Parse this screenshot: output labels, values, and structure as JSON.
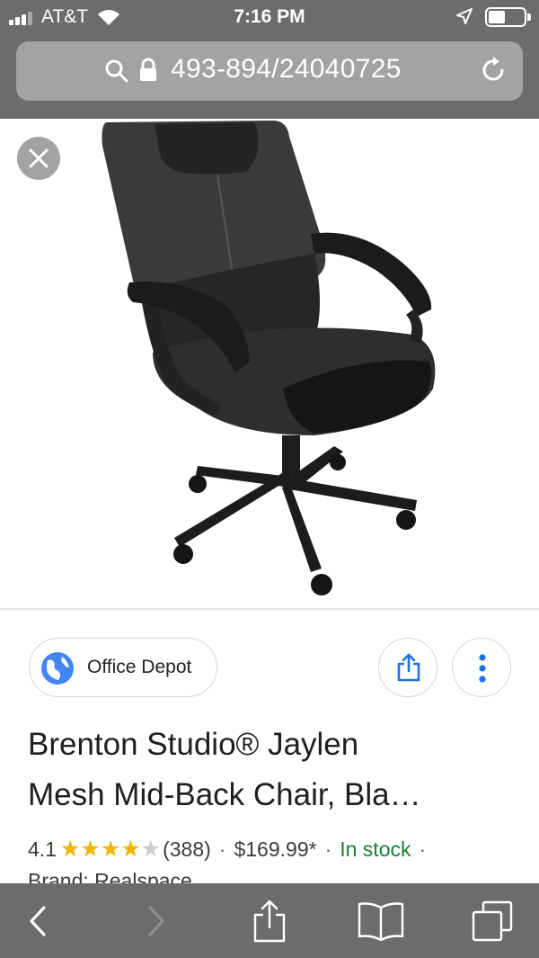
{
  "status_bar": {
    "carrier": "AT&T",
    "time": "7:16 PM"
  },
  "url_bar": {
    "url": "493-894/24040725"
  },
  "source": {
    "name": "Office Depot"
  },
  "product": {
    "title_line1": "Brenton Studio® Jaylen",
    "title_line2": "Mesh Mid-Back Chair, Bla…",
    "rating": "4.1",
    "rating_value": 4.1,
    "rating_max": 5,
    "review_count": "(388)",
    "price": "$169.99*",
    "availability": "In stock",
    "brand_partial": "Brand: Realspace"
  },
  "colors": {
    "chrome": "#6c6c6c",
    "url_bar": "#a3a3a3",
    "star": "#f4b400",
    "in_stock": "#188038",
    "link_blue": "#1a73e8"
  },
  "icons": {
    "toolbar": [
      "back-icon",
      "forward-icon",
      "share-icon",
      "bookmarks-icon",
      "tabs-icon"
    ]
  }
}
